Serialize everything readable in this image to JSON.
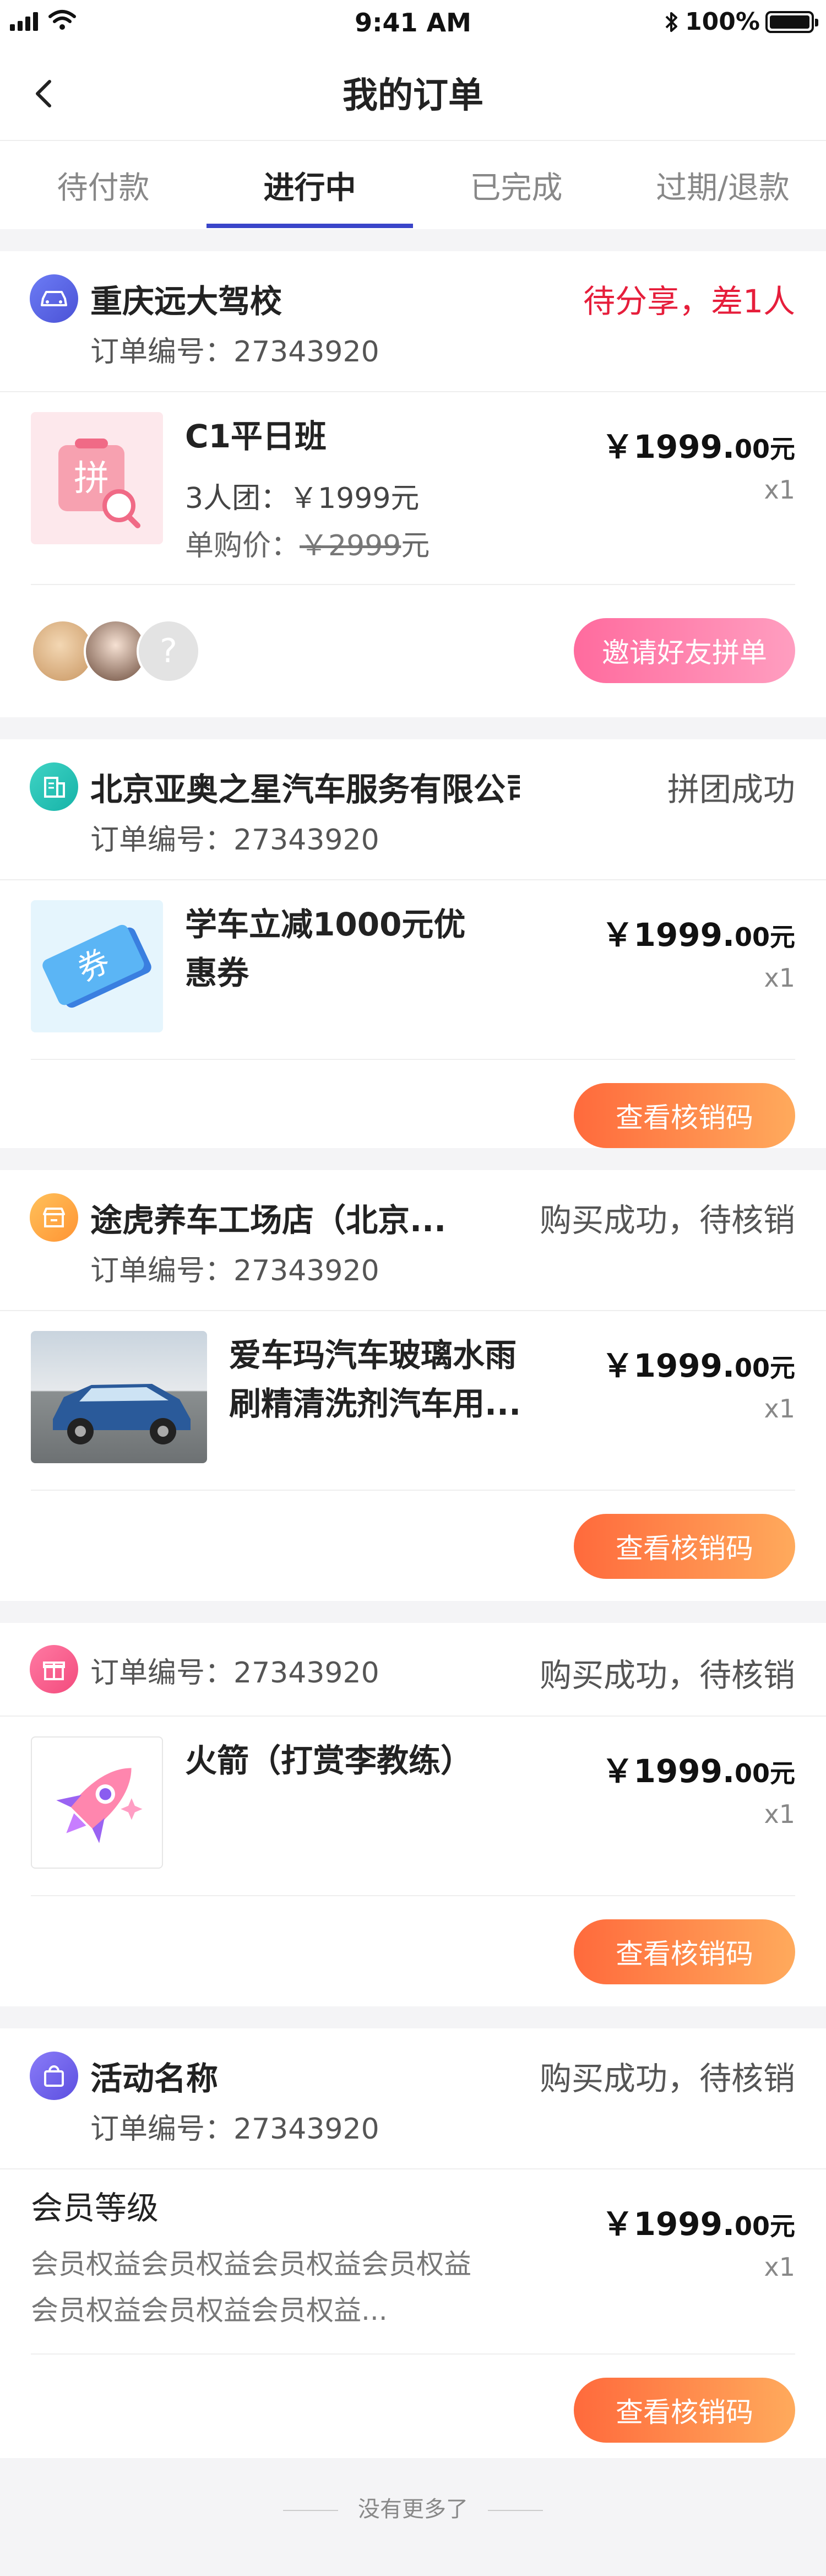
{
  "status_bar": {
    "time": "9:41 AM",
    "battery": "100%"
  },
  "nav": {
    "title": "我的订单"
  },
  "tabs": [
    {
      "label": "待付款",
      "active": false
    },
    {
      "label": "进行中",
      "active": true
    },
    {
      "label": "已完成",
      "active": false
    },
    {
      "label": "过期/退款",
      "active": false
    }
  ],
  "orders": [
    {
      "shop": "重庆远大驾校",
      "order_no": "订单编号：27343920",
      "status": "待分享，差1人",
      "item": {
        "title": "C1平日班",
        "group": "3人团：￥1999元",
        "single_label": "单购价：",
        "single_price": "￥2999",
        "single_unit": "元",
        "price_main": "￥1999.",
        "price_dec": "00元",
        "qty": "x1"
      },
      "button": "邀请好友拼单"
    },
    {
      "shop": "北京亚奥之星汽车服务有限公司",
      "order_no": "订单编号：27343920",
      "status": "拼团成功",
      "item": {
        "title_line1": "学车立减1000元优",
        "title_line2": "惠券",
        "price_main": "￥1999.",
        "price_dec": "00元",
        "qty": "x1"
      },
      "button": "查看核销码"
    },
    {
      "shop": "途虎养车工场店（北京...",
      "order_no": "订单编号：27343920",
      "status": "购买成功，待核销",
      "item": {
        "title_line1": "爱车玛汽车玻璃水雨",
        "title_line2": "刷精清洗剂汽车用...",
        "price_main": "￥1999.",
        "price_dec": "00元",
        "qty": "x1"
      },
      "button": "查看核销码"
    },
    {
      "order_no": "订单编号：27343920",
      "status": "购买成功，待核销",
      "item": {
        "title": "火箭（打赏李教练）",
        "price_main": "￥1999.",
        "price_dec": "00元",
        "qty": "x1"
      },
      "button": "查看核销码"
    },
    {
      "shop": "活动名称",
      "order_no": "订单编号：27343920",
      "status": "购买成功，待核销",
      "item": {
        "title": "会员等级",
        "desc_line1": "会员权益会员权益会员权益会员权益",
        "desc_line2": "会员权益会员权益会员权益...",
        "price_main": "￥1999.",
        "price_dec": "00元",
        "qty": "x1"
      },
      "button": "查看核销码"
    }
  ],
  "footer": "没有更多了",
  "colors": {
    "accent": "#3a45c9",
    "status_red": "#e61e3b",
    "orange_btn": "#ff7a40",
    "pink_btn": "#ff7aa8"
  }
}
